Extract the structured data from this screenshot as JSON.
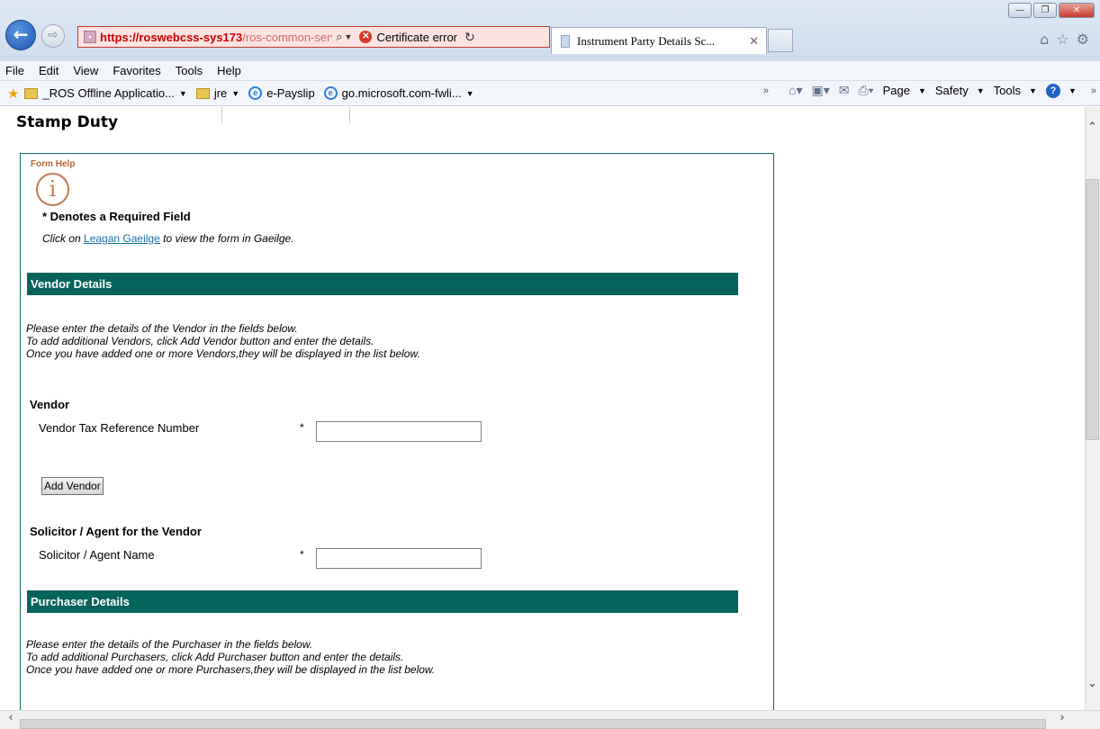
{
  "browser": {
    "url_host": "https://roswebcss-sys173",
    "url_path": "/ros-common-servic",
    "cert_error": "Certificate error",
    "tab_title": "Instrument Party Details Sc...",
    "menu": [
      "File",
      "Edit",
      "View",
      "Favorites",
      "Tools",
      "Help"
    ],
    "favorites": [
      {
        "label": "_ROS Offline Applicatio...",
        "icon": "folder-icon"
      },
      {
        "label": "jre",
        "icon": "folder-icon"
      },
      {
        "label": "e-Payslip",
        "icon": "ie-page-icon"
      },
      {
        "label": "go.microsoft.com-fwli...",
        "icon": "ie-page-icon"
      }
    ],
    "command_bar": {
      "page": "Page",
      "safety": "Safety",
      "tools": "Tools"
    }
  },
  "page": {
    "title": "Stamp Duty",
    "form_help_label": "Form Help",
    "required_note": "* Denotes a Required Field",
    "gaeilge_prefix": "Click on",
    "gaeilge_link": "Leagan Gaeilge",
    "gaeilge_suffix": "to view the form in Gaeilge."
  },
  "vendor_section": {
    "header": "Vendor Details",
    "instructions": [
      "Please enter the details of the Vendor in the fields below.",
      "To add additional Vendors, click Add Vendor button and enter the details.",
      "Once you have added one or more Vendors,they will be displayed in the list below."
    ],
    "subheading": "Vendor",
    "tax_ref_label": "Vendor Tax Reference Number",
    "tax_ref_value": "",
    "required_star": "*",
    "add_button": "Add Vendor",
    "solicitor_subheading": "Solicitor / Agent for the Vendor",
    "solicitor_label": "Solicitor / Agent Name",
    "solicitor_value": ""
  },
  "purchaser_section": {
    "header": "Purchaser Details",
    "instructions": [
      "Please enter the details of the Purchaser in the fields below.",
      "To add additional Purchasers, click Add Purchaser button and enter the details.",
      "Once you have added one or more Purchasers,they will be displayed in the list below."
    ]
  },
  "colors": {
    "section_header": "#07645c",
    "panel_border": "#0b6a62",
    "help_icon": "#c07a50",
    "link": "#1b6fa8"
  }
}
